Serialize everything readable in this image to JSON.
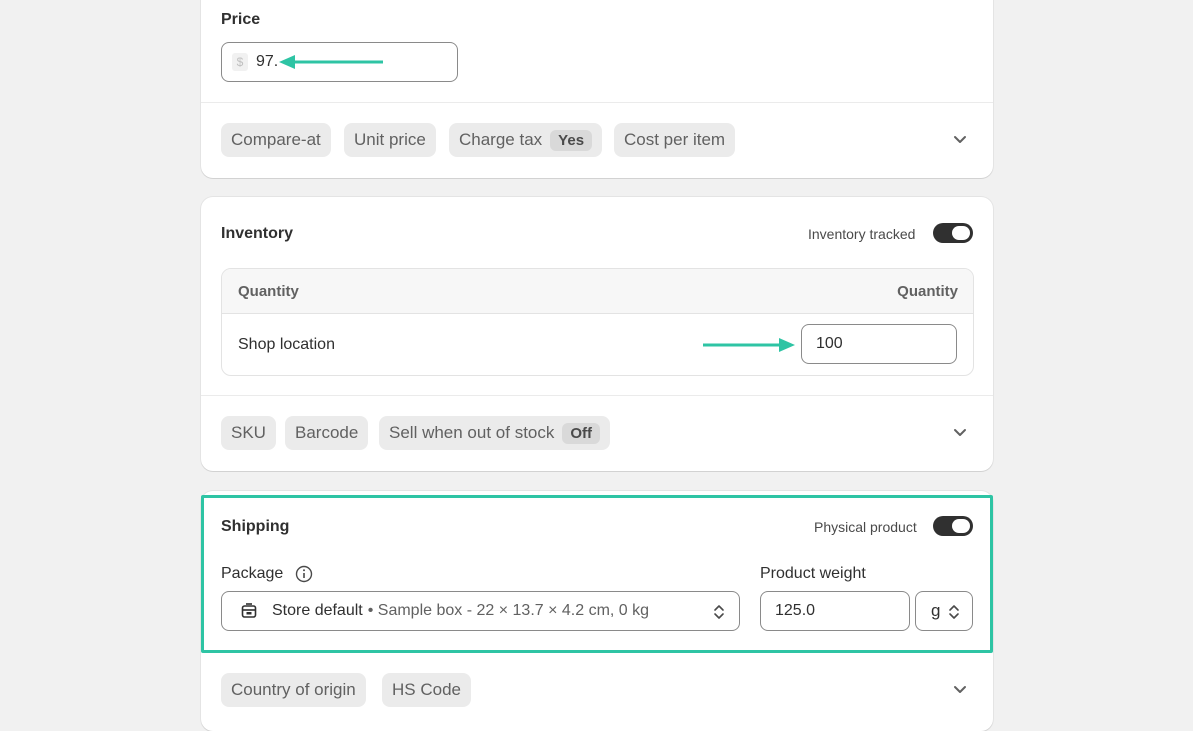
{
  "price": {
    "label": "Price",
    "currency_symbol": "$",
    "value": "97.",
    "chips": [
      {
        "label": "Compare-at"
      },
      {
        "label": "Unit price"
      },
      {
        "label": "Charge tax",
        "pill": "Yes"
      },
      {
        "label": "Cost per item"
      }
    ]
  },
  "inventory": {
    "title": "Inventory",
    "toggle_label": "Inventory tracked",
    "table": {
      "col_left": "Quantity",
      "col_right": "Quantity",
      "rows": [
        {
          "location": "Shop location",
          "quantity": "100"
        }
      ]
    },
    "chips": [
      {
        "label": "SKU"
      },
      {
        "label": "Barcode"
      },
      {
        "label": "Sell when out of stock",
        "pill": "Off"
      }
    ]
  },
  "shipping": {
    "title": "Shipping",
    "toggle_label": "Physical product",
    "package_label": "Package",
    "package_default": "Store default",
    "package_detail": "• Sample box - 22 × 13.7 × 4.2 cm, 0 kg",
    "weight_label": "Product weight",
    "weight_value": "125.0",
    "weight_unit": "g",
    "chips": [
      {
        "label": "Country of origin"
      },
      {
        "label": "HS Code"
      }
    ]
  },
  "colors": {
    "highlight": "#2ec4a4",
    "toggle_on": "#303030"
  }
}
